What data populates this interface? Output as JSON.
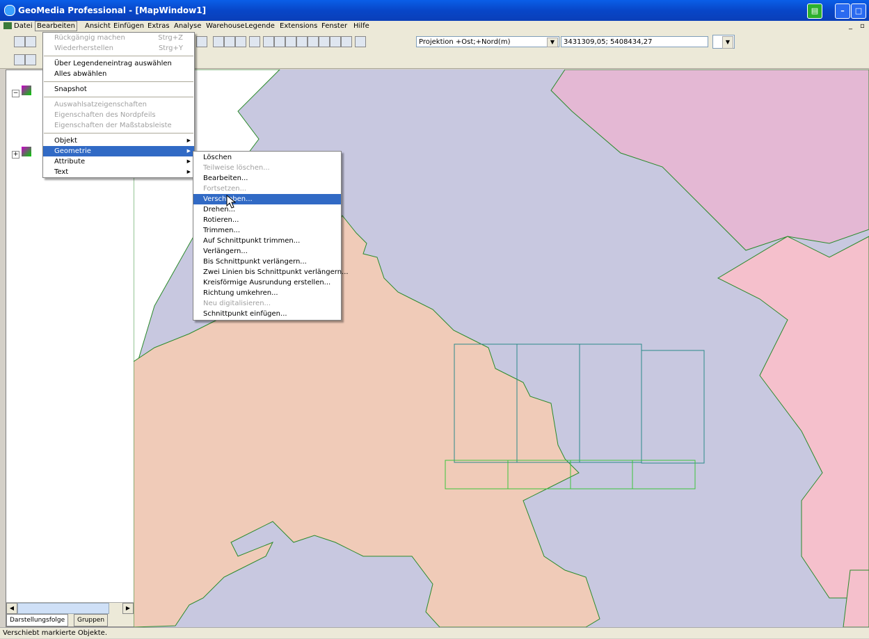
{
  "window": {
    "title": "GeoMedia Professional - [MapWindow1]"
  },
  "menubar": {
    "items": [
      "Datei",
      "Bearbeiten",
      "Ansicht",
      "Einfügen",
      "Extras",
      "Analyse",
      "Warehouse",
      "Legende",
      "Extensions",
      "Fenster",
      "Hilfe"
    ]
  },
  "toolbar": {
    "projection": "Projektion +Ost;+Nord(m)",
    "coordinates": "3431309,05; 5408434,27"
  },
  "legend": {
    "tab_display": "Darstellungsfolge",
    "tab_groups": "Gruppen"
  },
  "edit_menu": {
    "undo": "Rückgängig machen",
    "undo_acc": "Strg+Z",
    "redo": "Wiederherstellen",
    "redo_acc": "Strg+Y",
    "select_by_legend": "Über Legendeneintrag auswählen",
    "deselect_all": "Alles abwählen",
    "snapshot": "Snapshot",
    "selection_props": "Auswahlsatzeigenschaften",
    "north_arrow_props": "Eigenschaften des Nordpfeils",
    "scale_bar_props": "Eigenschaften der Maßstabsleiste",
    "object": "Objekt",
    "geometry": "Geometrie",
    "attribute": "Attribute",
    "text": "Text"
  },
  "geometry_menu": {
    "items": [
      {
        "label": "Löschen",
        "enabled": true
      },
      {
        "label": "Teilweise löschen...",
        "enabled": false
      },
      {
        "label": "Bearbeiten...",
        "enabled": true
      },
      {
        "label": "Fortsetzen...",
        "enabled": false
      },
      {
        "label": "Verschieben...",
        "enabled": true
      },
      {
        "label": "Drehen...",
        "enabled": true
      },
      {
        "label": "Rotieren...",
        "enabled": true
      },
      {
        "label": "Trimmen...",
        "enabled": true
      },
      {
        "label": "Auf Schnittpunkt trimmen...",
        "enabled": true
      },
      {
        "label": "Verlängern...",
        "enabled": true
      },
      {
        "label": "Bis Schnittpunkt verlängern...",
        "enabled": true
      },
      {
        "label": "Zwei Linien bis Schnittpunkt verlängern...",
        "enabled": true
      },
      {
        "label": "Kreisförmige Ausrundung erstellen...",
        "enabled": true
      },
      {
        "label": "Richtung umkehren...",
        "enabled": true
      },
      {
        "label": "Neu digitalisieren...",
        "enabled": false
      },
      {
        "label": "Schnittpunkt einfügen...",
        "enabled": true
      }
    ],
    "highlighted": "Verschieben..."
  },
  "status": {
    "text": "Verschiebt markierte Objekte."
  },
  "colors": {
    "map_bg": "#c8c8e0",
    "region_salmon": "#f0cbb8",
    "region_violet": "#e4b8d4",
    "region_pink": "#f5c0cc",
    "grid_teal": "#2b8a8a",
    "grid_green": "#3cc43c",
    "menu_highlight": "#316ac5"
  }
}
